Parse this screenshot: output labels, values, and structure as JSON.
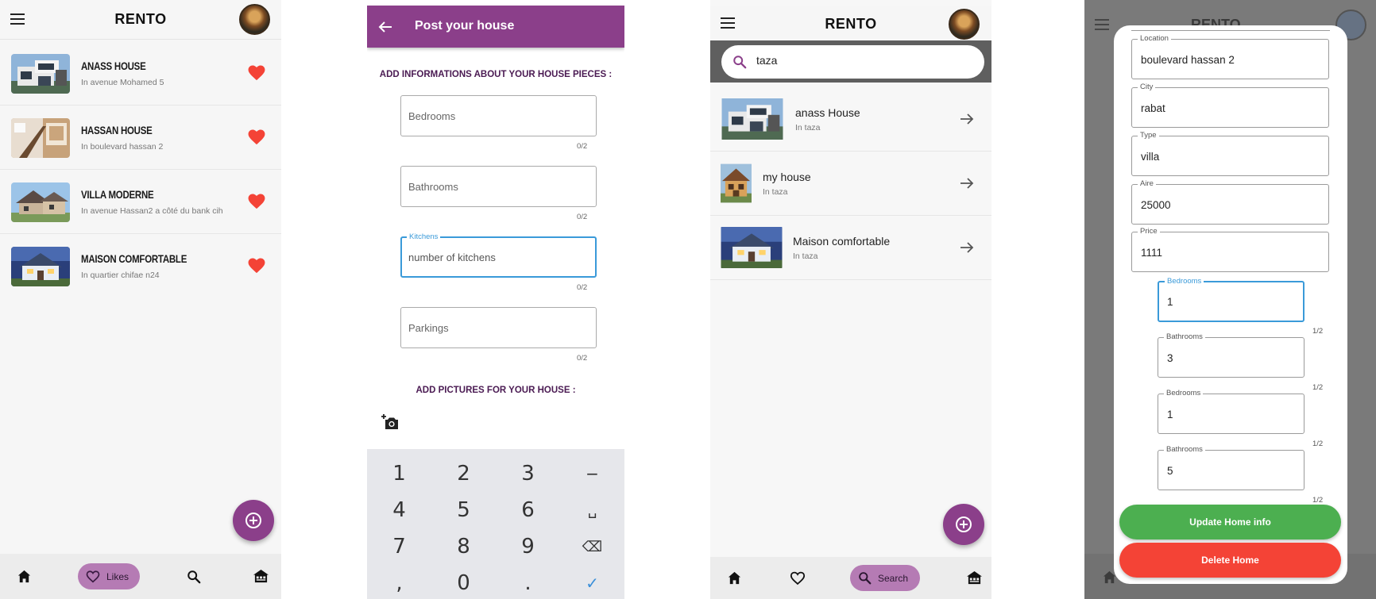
{
  "s1": {
    "brand": "RENTO",
    "houses": [
      {
        "title": "ANASS HOUSE",
        "sub": "In avenue Mohamed 5"
      },
      {
        "title": "HASSAN HOUSE",
        "sub": "In  boulevard hassan 2"
      },
      {
        "title": "VILLA MODERNE",
        "sub": "In avenue Hassan2 a côté du bank cih"
      },
      {
        "title": "MAISON COMFORTABLE",
        "sub": "In quartier chifae n24"
      }
    ],
    "nav": {
      "likes_label": "Likes"
    }
  },
  "s2": {
    "title": "Post your house",
    "section1": "ADD INFORMATIONS ABOUT YOUR HOUSE PIECES :",
    "fields": [
      {
        "placeholder": "Bedrooms",
        "counter": "0/2"
      },
      {
        "placeholder": "Bathrooms",
        "counter": "0/2"
      },
      {
        "label": "Kitchens",
        "placeholder": "number of kitchens",
        "counter": "0/2"
      },
      {
        "placeholder": "Parkings",
        "counter": "0/2"
      }
    ],
    "section2": "ADD PICTURES FOR YOUR HOUSE  :",
    "keys": [
      "1",
      "2",
      "3",
      "−",
      "4",
      "5",
      "6",
      "␣",
      "7",
      "8",
      "9",
      "⌫",
      ",",
      "0",
      ".",
      "✓"
    ]
  },
  "s3": {
    "brand": "RENTO",
    "search_value": "taza",
    "results": [
      {
        "title": "anass House",
        "sub": "In taza"
      },
      {
        "title": "my house",
        "sub": "In taza"
      },
      {
        "title": "Maison comfortable",
        "sub": "In taza"
      }
    ],
    "nav": {
      "search_label": "Search"
    }
  },
  "s4": {
    "bg_brand": "RENTO",
    "fields": [
      {
        "label": "Location",
        "value": "boulevard hassan 2"
      },
      {
        "label": "City",
        "value": "rabat"
      },
      {
        "label": "Type",
        "value": "villa"
      },
      {
        "label": "Aire",
        "value": "25000"
      },
      {
        "label": "Price",
        "value": "1111"
      }
    ],
    "small_fields": [
      {
        "label": "Bedrooms",
        "value": "1",
        "counter": "1/2"
      },
      {
        "label": "Bathrooms",
        "value": "3",
        "counter": "1/2"
      },
      {
        "label": "Bedrooms",
        "value": "1",
        "counter": "1/2"
      },
      {
        "label": "Bathrooms",
        "value": "5",
        "counter": "1/2"
      }
    ],
    "update_label": "Update Home info",
    "delete_label": "Delete Home"
  },
  "colors": {
    "accent": "#8b3f8a",
    "pill": "#b57bb4",
    "heart": "#f44336",
    "focus": "#3a9ad9",
    "green": "#4caf50",
    "red": "#f44336"
  }
}
